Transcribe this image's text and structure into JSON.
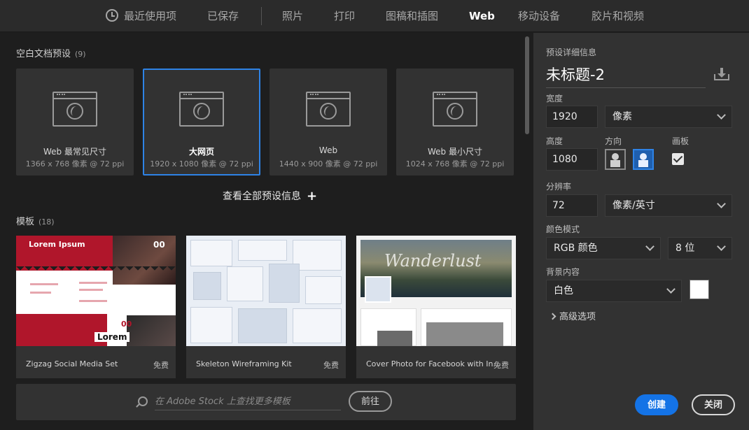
{
  "tabs": [
    {
      "label": "最近使用项",
      "icon": "clock-icon",
      "active": false
    },
    {
      "label": "已保存",
      "active": false
    },
    {
      "label": "照片",
      "active": false
    },
    {
      "label": "打印",
      "active": false
    },
    {
      "label": "图稿和插图",
      "active": false
    },
    {
      "label": "Web",
      "active": true
    },
    {
      "label": "移动设备",
      "active": false
    },
    {
      "label": "胶片和视频",
      "active": false
    }
  ],
  "blank_presets": {
    "title": "空白文档预设",
    "count": "(9)",
    "items": [
      {
        "name": "Web 最常见尺寸",
        "size": "1366 x 768 像素 @ 72 ppi",
        "selected": false
      },
      {
        "name": "大网页",
        "size": "1920 x 1080 像素 @ 72 ppi",
        "selected": true
      },
      {
        "name": "Web",
        "size": "1440 x 900 像素 @ 72 ppi",
        "selected": false
      },
      {
        "name": "Web 最小尺寸",
        "size": "1024 x 768 像素 @ 72 ppi",
        "selected": false
      }
    ],
    "view_all": "查看全部预设信息"
  },
  "templates": {
    "title": "模板",
    "count": "(18)",
    "items": [
      {
        "name": "Zigzag Social Media Set",
        "price": "免费",
        "thumb_text_1": "Lorem Ipsum",
        "thumb_text_2": "Lorem",
        "thumb_num_1": "00",
        "thumb_num_2": "00"
      },
      {
        "name": "Skeleton Wireframing Kit",
        "price": "免费"
      },
      {
        "name": "Cover Photo for Facebook with In...",
        "price": "免费",
        "thumb_text": "Wanderlust"
      }
    ]
  },
  "search": {
    "placeholder": "在 Adobe Stock 上查找更多模板",
    "go_label": "前往"
  },
  "details": {
    "heading": "预设详细信息",
    "doc_name": "未标题-2",
    "width_label": "宽度",
    "width_value": "1920",
    "width_unit": "像素",
    "height_label": "高度",
    "height_value": "1080",
    "orientation_label": "方向",
    "artboard_label": "画板",
    "artboard_checked": true,
    "resolution_label": "分辨率",
    "resolution_value": "72",
    "resolution_unit": "像素/英寸",
    "color_mode_label": "颜色模式",
    "color_mode_value": "RGB 颜色",
    "bit_depth_value": "8 位",
    "background_label": "背景内容",
    "background_value": "白色",
    "background_color": "#ffffff",
    "advanced_label": "高级选项",
    "create_label": "创建",
    "close_label": "关闭"
  },
  "colors": {
    "accent": "#1473e6",
    "selection": "#2e83e6",
    "panel": "#323232",
    "background": "#1e1e1e"
  }
}
